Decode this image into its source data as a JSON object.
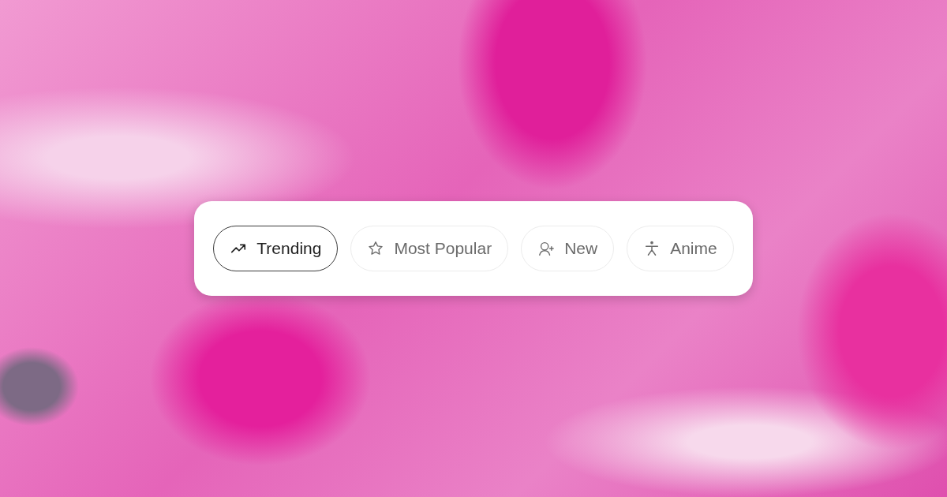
{
  "tabs": [
    {
      "label": "Trending",
      "selected": true
    },
    {
      "label": "Most Popular",
      "selected": false
    },
    {
      "label": "New",
      "selected": false
    },
    {
      "label": "Anime",
      "selected": false
    }
  ]
}
